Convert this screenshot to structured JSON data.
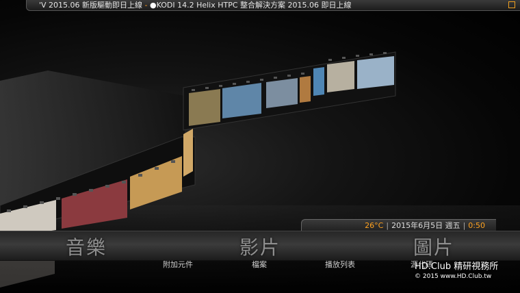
{
  "ticker": {
    "part1": "'V 2015.06 新版驅動即日上線",
    "separator": " - ",
    "bullet": "●",
    "part2": "KODI 14.2 Helix HTPC 整合解決方案 2015.06 即日上線"
  },
  "info": {
    "temperature": "26°C",
    "date": "2015年6月5日 週五",
    "time": "0:50",
    "divider": "|"
  },
  "menu": {
    "items": [
      {
        "label": "音樂"
      },
      {
        "label": "影片"
      },
      {
        "label": "圖片"
      }
    ],
    "submenu": [
      {
        "label": "附加元件"
      },
      {
        "label": "檔案"
      },
      {
        "label": "播放列表"
      },
      {
        "label": "源代碼"
      }
    ]
  },
  "watermark": {
    "line1": "HD.Club 精研視務所",
    "line2": "© 2015  www.HD.Club.tw"
  },
  "colors": {
    "accent": "#ffa21f",
    "menu_text": "#8f8f8f",
    "background": "#000000"
  }
}
